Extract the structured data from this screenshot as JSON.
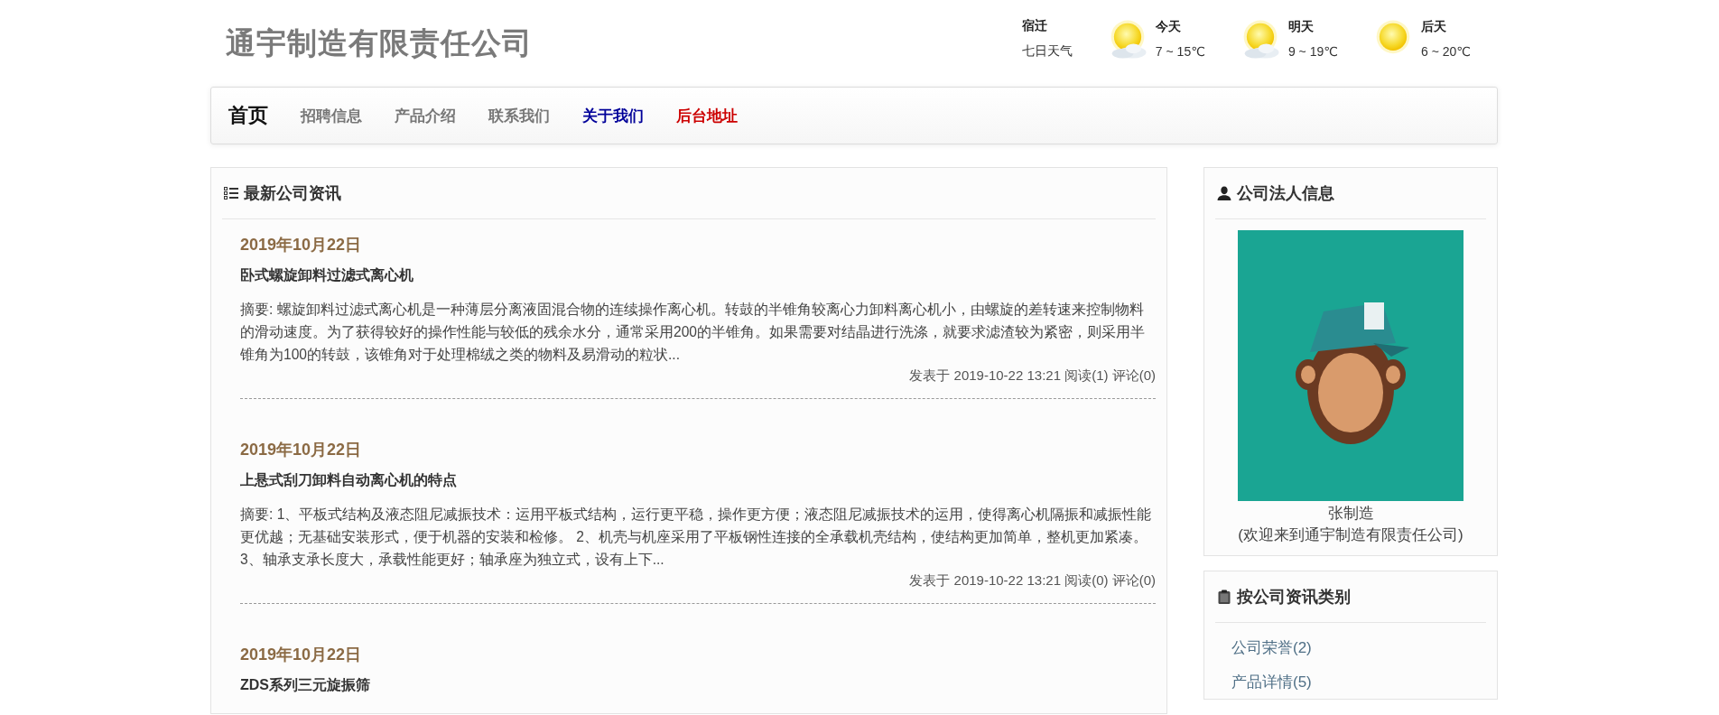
{
  "site_title": "通宇制造有限责任公司",
  "weather": {
    "city": "宿迁",
    "caption": "七日天气",
    "days": [
      {
        "label": "今天",
        "range": "7 ~ 15℃",
        "kind": "sun-cloud"
      },
      {
        "label": "明天",
        "range": "9 ~ 19℃",
        "kind": "sun-cloud"
      },
      {
        "label": "后天",
        "range": "6 ~ 20℃",
        "kind": "sun"
      }
    ]
  },
  "nav": [
    {
      "label": "首页",
      "selected": true
    },
    {
      "label": "招聘信息",
      "selected": false
    },
    {
      "label": "产品介绍",
      "selected": false
    },
    {
      "label": "联系我们",
      "selected": false
    },
    {
      "label": "关于我们",
      "selected": false,
      "color": "#000099"
    },
    {
      "label": "后台地址",
      "selected": false,
      "color": "#cc0000"
    }
  ],
  "news": {
    "heading": "最新公司资讯",
    "articles": [
      {
        "date": "2019年10月22日",
        "title": "卧式螺旋卸料过滤式离心机",
        "summary": "摘要: 螺旋卸料过滤式离心机是一种薄层分离液固混合物的连续操作离心机。转鼓的半锥角较离心力卸料离心机小，由螺旋的差转速来控制物料的滑动速度。为了获得较好的操作性能与较低的残余水分，通常采用200的半锥角。如果需要对结晶进行洗涤，就要求滤渣较为紧密，则采用半锥角为100的转鼓，该锥角对于处理棉绒之类的物料及易滑动的粒状...",
        "meta": "发表于 2019-10-22 13:21 阅读(1) 评论(0)"
      },
      {
        "date": "2019年10月22日",
        "title": "上悬式刮刀卸料自动离心机的特点",
        "summary": "摘要: 1、平板式结构及液态阻尼减振技术：运用平板式结构，运行更平稳，操作更方便；液态阻尼减振技术的运用，使得离心机隔振和减振性能更优越；无基础安装形式，便于机器的安装和检修。 2、机壳与机座采用了平板钢性连接的全承载机壳结构，使结构更加简单，整机更加紧凑。 3、轴承支承长度大，承载性能更好；轴承座为独立式，设有上下...",
        "meta": "发表于 2019-10-22 13:21 阅读(0) 评论(0)"
      },
      {
        "date": "2019年10月22日",
        "title": "ZDS系列三元旋振筛"
      }
    ]
  },
  "owner": {
    "heading": "公司法人信息",
    "name": "张制造",
    "greeting": "(欢迎来到通宇制造有限责任公司)"
  },
  "categories": {
    "heading": "按公司资讯类别",
    "items": [
      "公司荣誉(2)",
      "产品详情(5)"
    ]
  }
}
